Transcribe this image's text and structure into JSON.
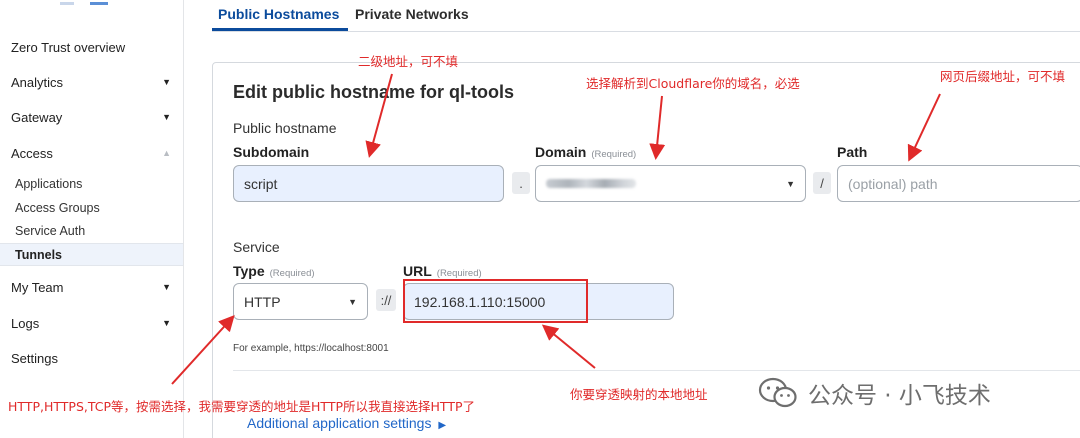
{
  "sidebar": {
    "items": [
      {
        "label": "Zero Trust overview"
      },
      {
        "label": "Analytics"
      },
      {
        "label": "Gateway"
      },
      {
        "label": "Access"
      }
    ],
    "access_children": [
      "Applications",
      "Access Groups",
      "Service Auth",
      "Tunnels"
    ],
    "items_after": [
      {
        "label": "My Team"
      },
      {
        "label": "Logs"
      },
      {
        "label": "Settings"
      }
    ],
    "chevron_down": "▼",
    "chevron_up": "▲"
  },
  "tabs": [
    "Public Hostnames",
    "Private Networks"
  ],
  "form": {
    "title": "Edit public hostname for ql-tools",
    "public_hostname_label": "Public hostname",
    "subdomain_label": "Subdomain",
    "subdomain_value": "script",
    "dot_separator": ".",
    "domain_label": "Domain",
    "required_text": "(Required)",
    "slash_separator": "/",
    "path_label": "Path",
    "path_placeholder": "(optional) path",
    "service_label": "Service",
    "type_label": "Type",
    "type_value": "HTTP",
    "scheme_separator": "://",
    "url_label": "URL",
    "url_value": "192.168.1.110:15000",
    "helper_text": "For example, https://localhost:8001",
    "additional_settings": "Additional application settings",
    "additional_settings_arrow": "▶"
  },
  "annotations": {
    "subdomain_note": "二级地址，可不填",
    "domain_note": "选择解析到Cloudflare你的域名，必选",
    "path_note": "网页后缀地址，可不填",
    "type_note": "HTTP,HTTPS,TCP等，按需选择，我需要穿透的地址是HTTP所以我直接选择HTTP了",
    "url_note": "你要穿透映射的本地地址"
  },
  "watermark": {
    "text": "公众号 · 小飞技术",
    "icon": "wechat-icon"
  },
  "colors": {
    "accent": "#0b4b9c",
    "annotation": "#e02a2a",
    "link": "#2167c8",
    "input_fill": "#e8f0fe"
  }
}
